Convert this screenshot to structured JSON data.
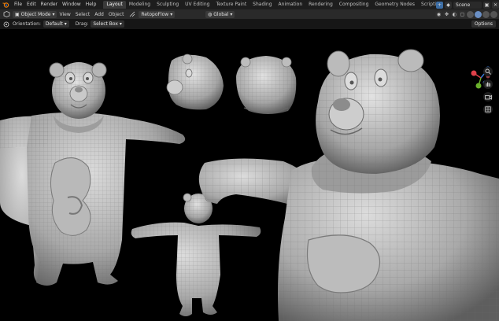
{
  "topbar": {
    "menus": [
      "File",
      "Edit",
      "Render",
      "Window",
      "Help"
    ],
    "workspaces": [
      "Layout",
      "Modeling",
      "Sculpting",
      "UV Editing",
      "Texture Paint",
      "Shading",
      "Animation",
      "Rendering",
      "Compositing",
      "Geometry Nodes",
      "Scripting"
    ],
    "active_workspace": "Layout",
    "scene_name": "Scene"
  },
  "header": {
    "mode": "Object Mode",
    "menus": [
      "View",
      "Select",
      "Add",
      "Object"
    ],
    "transform_orientation": "Global",
    "snap_target": "RetopoFlow"
  },
  "tool_header": {
    "orientation_label": "Orientation:",
    "orientation_value": "Default",
    "drag_label": "Drag:",
    "drag_value": "Select Box",
    "options_label": "Options"
  },
  "colors": {
    "accent": "#4772b3",
    "gizmo_x": "#e0404a",
    "gizmo_y": "#6ab02c",
    "gizmo_z": "#3b7fe0",
    "background": "#000000",
    "mesh": "#a8a8a8"
  },
  "icons": {
    "logo": "blender-logo-icon",
    "editor_type": "3d-viewport-icon",
    "zoom": "zoom-icon",
    "pan": "hand-pan-icon",
    "camera": "camera-icon",
    "perspective": "grid-perspective-icon"
  }
}
